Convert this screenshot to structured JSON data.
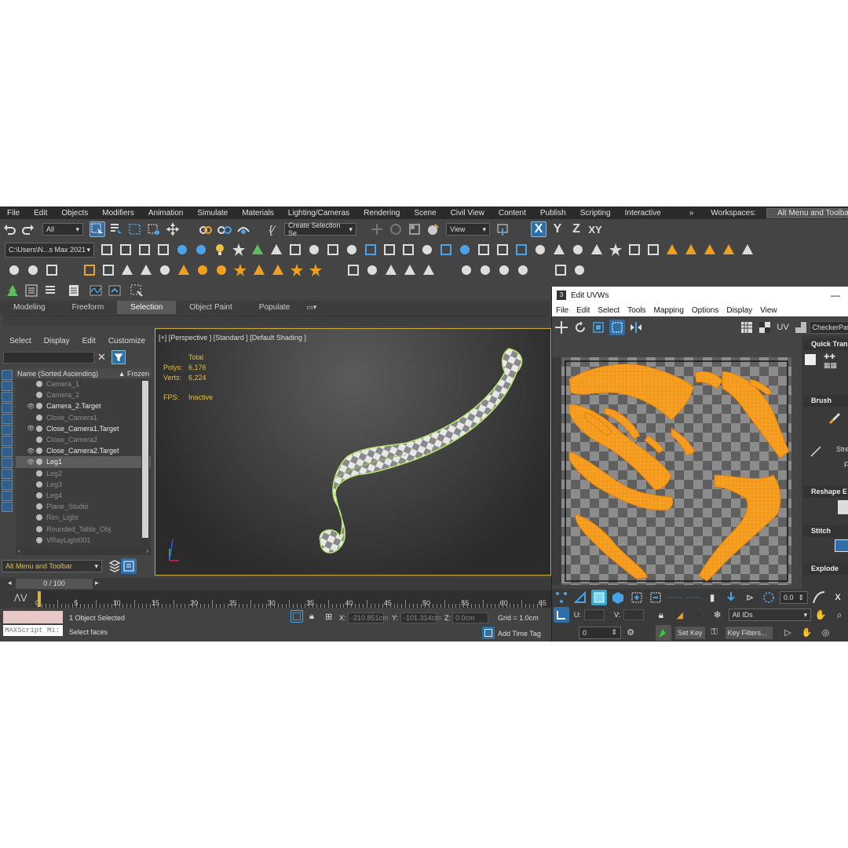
{
  "menubar": {
    "items": [
      "File",
      "Edit",
      "Objects",
      "Modifiers",
      "Animation",
      "Simulate",
      "Materials",
      "Lighting/Cameras",
      "Rendering",
      "Scene",
      "Civil View",
      "Content",
      "Publish",
      "Scripting",
      "Interactive"
    ],
    "workspaces_label": "Workspaces:",
    "workspace_value": "Alt Menu and Toolbar"
  },
  "toolbar1": {
    "filter_value": "All",
    "selection_set": "Create Selection Se",
    "coord_system": "View",
    "axes": [
      "X",
      "Y",
      "Z",
      "XY"
    ]
  },
  "toolbar2": {
    "path": "C:\\Users\\N...s Max 2021"
  },
  "ribbon": {
    "tabs": [
      "Modeling",
      "Freeform",
      "Selection",
      "Object Paint",
      "Populate"
    ],
    "active": "Selection"
  },
  "scene_explorer": {
    "menu": [
      "Select",
      "Display",
      "Edit",
      "Customize"
    ],
    "col_name": "Name (Sorted Ascending)",
    "col_frozen": "▲ Frozen",
    "items": [
      {
        "name": "Camera_1",
        "visible": false,
        "selected": false
      },
      {
        "name": "Camera_2",
        "visible": false,
        "selected": false
      },
      {
        "name": "Camera_2.Target",
        "visible": true,
        "selected": false
      },
      {
        "name": "Close_Camera1",
        "visible": false,
        "selected": false
      },
      {
        "name": "Close_Camera1.Target",
        "visible": true,
        "selected": false
      },
      {
        "name": "Close_Camera2",
        "visible": false,
        "selected": false
      },
      {
        "name": "Close_Camera2.Target",
        "visible": true,
        "selected": false
      },
      {
        "name": "Leg1",
        "visible": true,
        "selected": true
      },
      {
        "name": "Leg2",
        "visible": false,
        "selected": false
      },
      {
        "name": "Leg3",
        "visible": false,
        "selected": false
      },
      {
        "name": "Leg4",
        "visible": false,
        "selected": false
      },
      {
        "name": "Plane_Studio",
        "visible": false,
        "selected": false
      },
      {
        "name": "Rim_Light",
        "visible": false,
        "selected": false
      },
      {
        "name": "Rounded_Table_Obj",
        "visible": false,
        "selected": false
      },
      {
        "name": "VRayLight001",
        "visible": false,
        "selected": false
      }
    ],
    "workspace_dropdown": "Alt Menu and Toolbar"
  },
  "viewport": {
    "label": "[+] [Perspective ] [Standard ] [Default Shading ]",
    "stats_total": "Total",
    "polys_label": "Polys:",
    "polys_value": "6,176",
    "verts_label": "Verts:",
    "verts_value": "6,224",
    "fps_label": "FPS:",
    "fps_value": "Inactive"
  },
  "timeline": {
    "frame": "0 / 100",
    "ticks": [
      "0",
      "5",
      "10",
      "15",
      "20",
      "25",
      "30",
      "35",
      "40",
      "45",
      "50",
      "55",
      "60",
      "65"
    ]
  },
  "status": {
    "maxscript": "MAXScript Mi:",
    "selected": "1 Object Selected",
    "prompt": "Select faces",
    "x_label": "X:",
    "x_value": "-210.851cm",
    "y_label": "Y:",
    "y_value": "-101.314cm",
    "z_label": "Z:",
    "z_value": "0.0cm",
    "grid": "Grid = 1.0cm",
    "add_time_tag": "Add Time Tag"
  },
  "uv_editor": {
    "title": "Edit UVWs",
    "menu": [
      "File",
      "Edit",
      "Select",
      "Tools",
      "Mapping",
      "Options",
      "Display",
      "View"
    ],
    "uv_label": "UV",
    "checker": "CheckerPatt",
    "sections": [
      "Quick Tran",
      "Brush",
      "Reshape E",
      "Stitch",
      "Explode"
    ],
    "brush_labels": [
      "Stre",
      "Fa"
    ],
    "u_label": "U:",
    "v_label": "V:",
    "spinner_value": "0.0",
    "ids_value": "All IDs",
    "bottom_value": "0",
    "set_key": "Set Key",
    "key_filters": "Key Filters..."
  },
  "colors": {
    "accent": "#f0a020",
    "selection_blue": "#2f6fa8",
    "uv_orange": "#f39a1d",
    "viewport_border": "#cfae3f"
  }
}
